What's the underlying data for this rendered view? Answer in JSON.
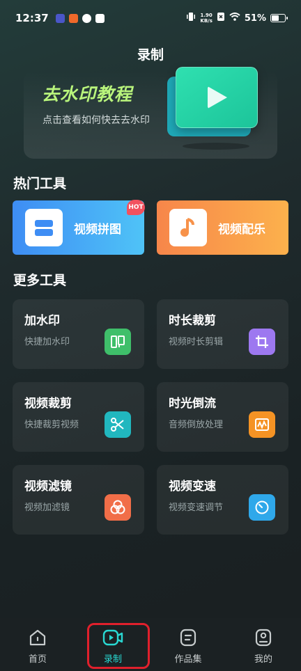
{
  "status": {
    "time": "12:37",
    "net_speed_value": "1.90",
    "net_speed_unit": "KB/s",
    "battery": "51%"
  },
  "page_title": "录制",
  "banner": {
    "title": "去水印教程",
    "subtitle": "点击查看如何快去去水印"
  },
  "hot_section": {
    "title": "热门工具",
    "badge": "HOT",
    "items": [
      {
        "label": "视频拼图",
        "icon": "collage-icon"
      },
      {
        "label": "视频配乐",
        "icon": "music-note-icon"
      }
    ]
  },
  "more_section": {
    "title": "更多工具",
    "items": [
      {
        "title": "加水印",
        "subtitle": "快捷加水印",
        "icon": "watermark-icon",
        "color": "#3fbf6a"
      },
      {
        "title": "时长裁剪",
        "subtitle": "视频时长剪辑",
        "icon": "crop-icon",
        "color": "#9d78f0"
      },
      {
        "title": "视频裁剪",
        "subtitle": "快捷裁剪视频",
        "icon": "scissors-icon",
        "color": "#21b7bf"
      },
      {
        "title": "时光倒流",
        "subtitle": "音频倒放处理",
        "icon": "waveform-icon",
        "color": "#f59324"
      },
      {
        "title": "视频滤镜",
        "subtitle": "视频加滤镜",
        "icon": "filter-icon",
        "color": "#f16e48"
      },
      {
        "title": "视频变速",
        "subtitle": "视频变速调节",
        "icon": "speedometer-icon",
        "color": "#2fa8ea"
      }
    ]
  },
  "tabbar": {
    "items": [
      {
        "label": "首页",
        "icon": "home-icon",
        "active": false
      },
      {
        "label": "录制",
        "icon": "record-icon",
        "active": true
      },
      {
        "label": "作品集",
        "icon": "portfolio-icon",
        "active": false
      },
      {
        "label": "我的",
        "icon": "profile-icon",
        "active": false
      }
    ]
  },
  "colors": {
    "accent": "#29d8d2",
    "highlight": "#e0202c",
    "banner_title": "#b9f57c"
  }
}
